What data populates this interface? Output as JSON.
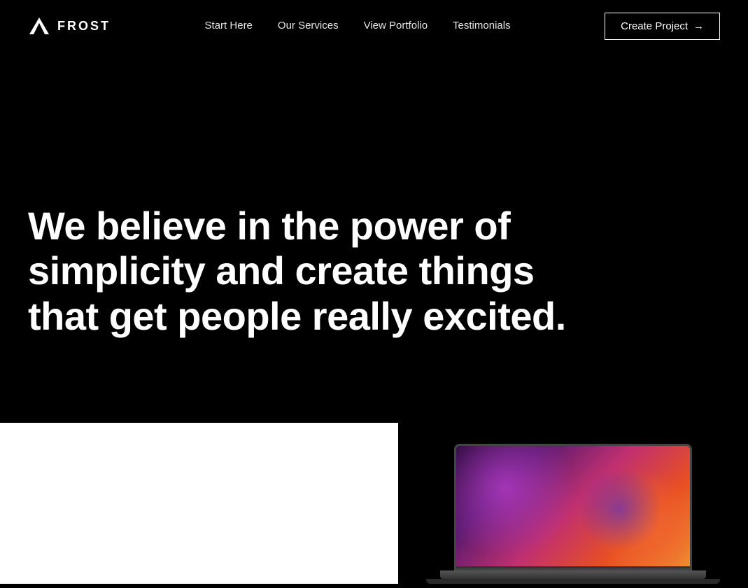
{
  "brand": {
    "name": "FROST",
    "logo_alt": "Frost logo"
  },
  "nav": {
    "links": [
      {
        "label": "Start Here",
        "href": "#"
      },
      {
        "label": "Our Services",
        "href": "#"
      },
      {
        "label": "View Portfolio",
        "href": "#"
      },
      {
        "label": "Testimonials",
        "href": "#"
      }
    ],
    "cta": {
      "label": "Create Project",
      "arrow": "→"
    }
  },
  "hero": {
    "headline": "We believe in the power of simplicity and create things that get people really excited."
  },
  "lower": {
    "text": ""
  },
  "colors": {
    "background": "#000000",
    "text": "#ffffff",
    "cta_border": "#ffffff"
  }
}
